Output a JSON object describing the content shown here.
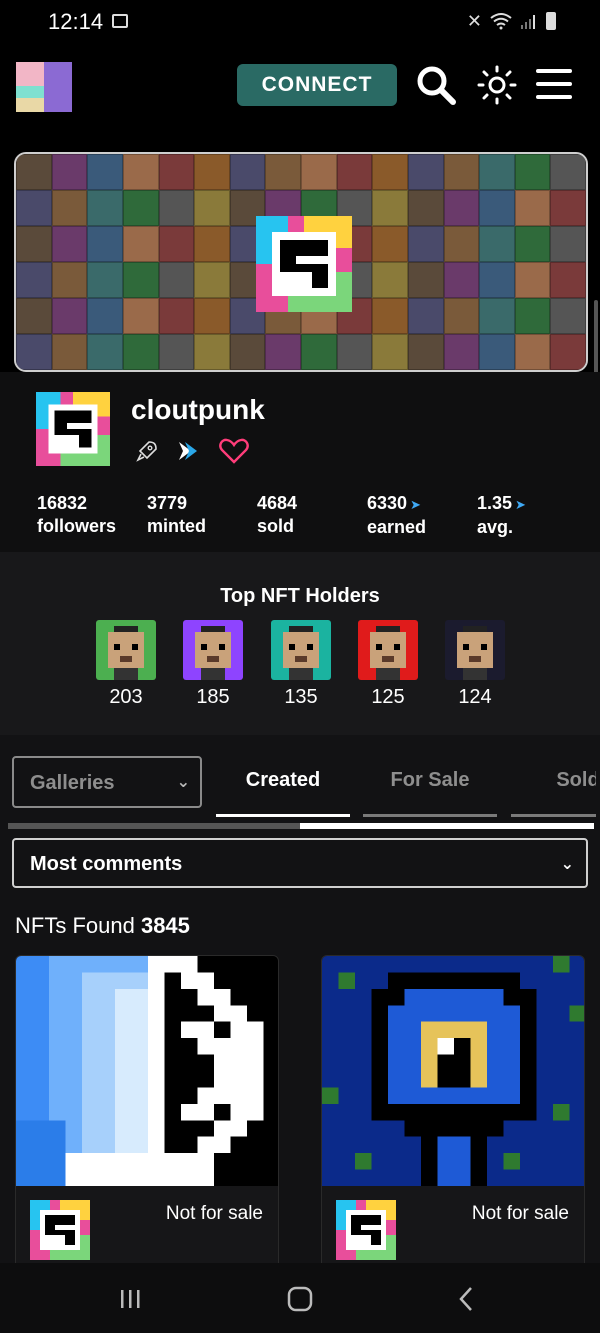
{
  "status_bar": {
    "time": "12:14",
    "icons": [
      "screenshot-icon",
      "mute-icon",
      "wifi-icon",
      "signal-icon",
      "battery-icon"
    ]
  },
  "header": {
    "connect_label": "CONNECT",
    "icons": [
      "search-icon",
      "theme-sun-icon",
      "hamburger-menu-icon"
    ]
  },
  "profile": {
    "name": "cloutpunk",
    "badges": [
      "rocket-icon",
      "tezos-arrow-icon",
      "heart-icon"
    ],
    "stats": [
      {
        "value": "16832",
        "label": "followers",
        "currency": false
      },
      {
        "value": "3779",
        "label": "minted",
        "currency": false
      },
      {
        "value": "4684",
        "label": "sold",
        "currency": false
      },
      {
        "value": "6330",
        "label": "earned",
        "currency": true
      },
      {
        "value": "1.35",
        "label": "avg.",
        "currency": true
      }
    ]
  },
  "top_holders": {
    "title": "Top NFT Holders",
    "holders": [
      {
        "count": "203",
        "color": "#4caf50"
      },
      {
        "count": "185",
        "color": "#8e44ff"
      },
      {
        "count": "135",
        "color": "#1bb3a0"
      },
      {
        "count": "125",
        "color": "#e01b1b"
      },
      {
        "count": "124",
        "color": "#1b1b2e"
      }
    ]
  },
  "tabs": {
    "gallery_select": "Galleries",
    "items": [
      {
        "label": "Created",
        "active": true
      },
      {
        "label": "For Sale",
        "active": false
      },
      {
        "label": "Sold",
        "active": false
      }
    ]
  },
  "sort": {
    "selected": "Most comments"
  },
  "results": {
    "prefix": "NFTs Found",
    "count": "3845"
  },
  "cards": [
    {
      "status": "Not for sale"
    },
    {
      "status": "Not for sale"
    }
  ],
  "colors": {
    "accent": "#2a6a64",
    "background": "#121214"
  }
}
